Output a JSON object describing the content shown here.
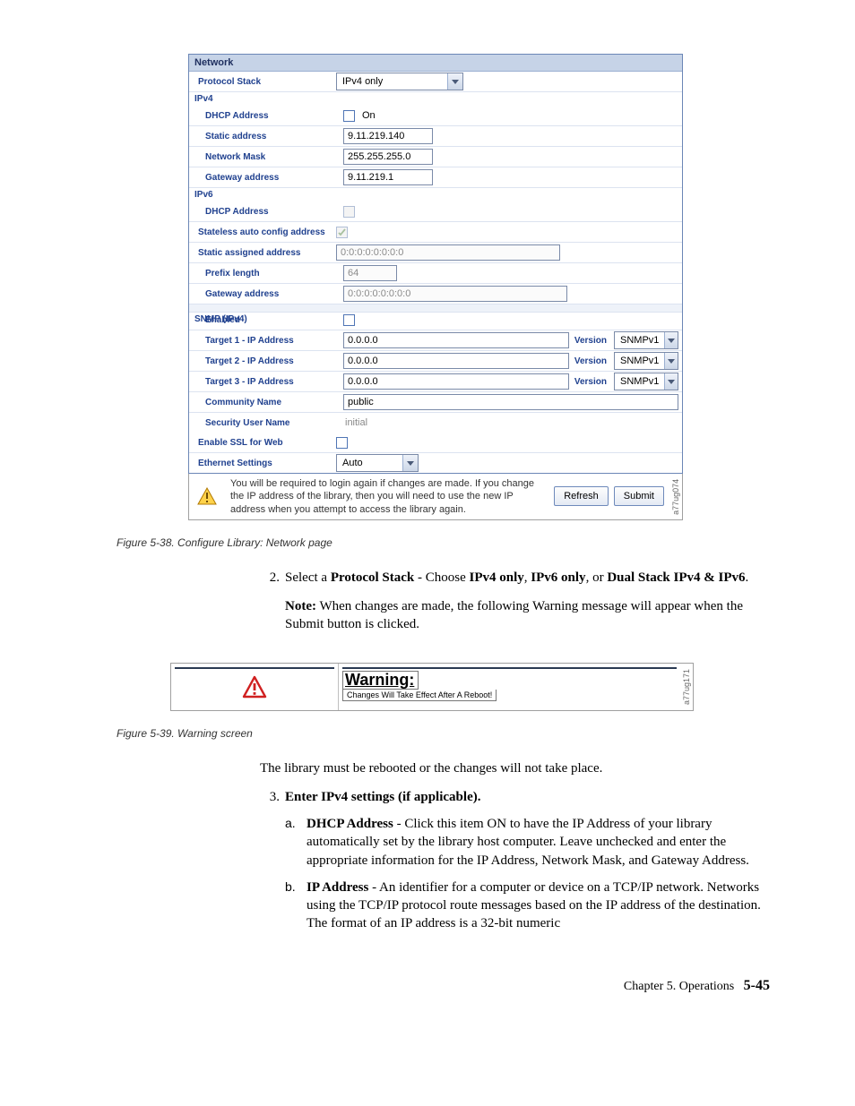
{
  "network": {
    "header": "Network",
    "protocol_label": "Protocol Stack",
    "protocol_value": "IPv4 only",
    "ipv4": {
      "section": "IPv4",
      "dhcp_label": "DHCP Address",
      "dhcp_on": "On",
      "static_label": "Static address",
      "static_value": "9.11.219.140",
      "mask_label": "Network Mask",
      "mask_value": "255.255.255.0",
      "gateway_label": "Gateway address",
      "gateway_value": "9.11.219.1"
    },
    "ipv6": {
      "section": "IPv6",
      "dhcp_label": "DHCP Address",
      "stateless_label": "Stateless auto config address",
      "static_label": "Static assigned address",
      "static_value": "0:0:0:0:0:0:0:0",
      "prefix_label": "Prefix length",
      "prefix_value": "64",
      "gateway_label": "Gateway address",
      "gateway_value": "0:0:0:0:0:0:0:0"
    },
    "snmp": {
      "section": "SNMP (IPv4)",
      "enabled_label": "Enabled",
      "t1_label": "Target 1 - IP Address",
      "t2_label": "Target 2 - IP Address",
      "t3_label": "Target 3 - IP Address",
      "target_value": "0.0.0.0",
      "version_label": "Version",
      "version_value": "SNMPv1",
      "community_label": "Community Name",
      "community_value": "public",
      "security_label": "Security User Name",
      "security_value": "initial",
      "ssl_label": "Enable SSL for Web",
      "eth_label": "Ethernet Settings",
      "eth_value": "Auto"
    },
    "footer_msg": "You will be required to login again if changes are made. If you change the IP address of the library, then you will need to use the new IP address when you attempt to access the library again.",
    "refresh": "Refresh",
    "submit": "Submit",
    "tag1": "a77ug074"
  },
  "caption1": "Figure 5-38. Configure Library: Network page",
  "step2": {
    "num": "2.",
    "pre": "Select a ",
    "b1": "Protocol Stack",
    "mid1": " - Choose ",
    "b2": "IPv4 only",
    "mid2": ", ",
    "b3": "IPv6 only",
    "mid3": ", or ",
    "b4": "Dual Stack IPv4 & IPv6",
    "end": "."
  },
  "note": {
    "label": "Note:",
    "text": " When changes are made, the following Warning message will appear when the Submit button is clicked."
  },
  "warn": {
    "title": "Warning:",
    "msg": "Changes Will Take Effect After A Reboot!",
    "tag": "a77ug171"
  },
  "caption2": "Figure 5-39. Warning screen",
  "after_warn": "The library must be rebooted or the changes will not take place.",
  "step3": {
    "num": "3.",
    "title": "Enter IPv4 settings (if applicable).",
    "a": {
      "num": "a.",
      "b": "DHCP Address",
      "text": " - Click this item ON to have the IP Address of your library automatically set by the library host computer. Leave unchecked and enter the appropriate information for the IP Address, Network Mask, and Gateway Address."
    },
    "b": {
      "num": "b.",
      "b": "IP Address",
      "text": " - An identifier for a computer or device on a TCP/IP network. Networks using the TCP/IP protocol route messages based on the IP address of the destination. The format of an IP address is a 32-bit numeric"
    }
  },
  "page_footer": {
    "chapter": "Chapter 5. Operations",
    "page": "5-45"
  }
}
